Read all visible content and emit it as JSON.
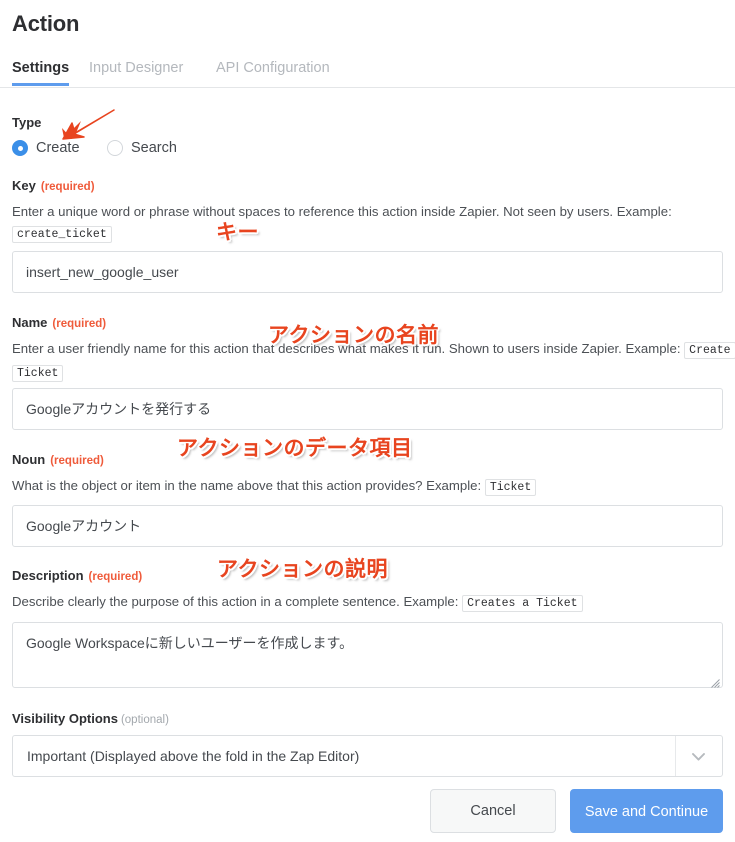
{
  "header": {
    "title": "Action"
  },
  "tabs": [
    {
      "label": "Settings",
      "active": true
    },
    {
      "label": "Input Designer",
      "active": false
    },
    {
      "label": "API Configuration",
      "active": false
    }
  ],
  "type_field": {
    "label": "Type",
    "options": [
      {
        "label": "Create",
        "selected": true
      },
      {
        "label": "Search",
        "selected": false
      }
    ]
  },
  "key_field": {
    "label": "Key",
    "requirement": "(required)",
    "help_before": "Enter a unique word or phrase without spaces to reference this action inside Zapier. Not seen by users. Example:",
    "help_example": "create_ticket",
    "value": "insert_new_google_user"
  },
  "name_field": {
    "label": "Name",
    "requirement": "(required)",
    "help_before": "Enter a user friendly name for this action that describes what makes it run. Shown to users inside Zapier. Example:",
    "help_example": "Create Ticket",
    "value": "Googleアカウントを発行する"
  },
  "noun_field": {
    "label": "Noun",
    "requirement": "(required)",
    "help_before": "What is the object or item in the name above that this action provides? Example:",
    "help_example": "Ticket",
    "value": "Googleアカウント"
  },
  "description_field": {
    "label": "Description",
    "requirement": "(required)",
    "help_before": "Describe clearly the purpose of this action in a complete sentence. Example:",
    "help_example": "Creates a Ticket",
    "value": "Google Workspaceに新しいユーザーを作成します。"
  },
  "visibility_field": {
    "label": "Visibility Options",
    "requirement": "(optional)",
    "value": "Important (Displayed above the fold in the Zap Editor)"
  },
  "footer": {
    "cancel_label": "Cancel",
    "save_label": "Save and Continue"
  },
  "annotations": [
    {
      "text": "キー"
    },
    {
      "text": "アクションの名前"
    },
    {
      "text": "アクションのデータ項目"
    },
    {
      "text": "アクションの説明"
    }
  ],
  "colors": {
    "accent_blue": "#5e9ced",
    "required_orange": "#ef5b3b",
    "annotation_red": "#e8441f",
    "text": "#2e2f32",
    "muted_tab": "#b4b8bd",
    "border": "#dcdfe2"
  }
}
